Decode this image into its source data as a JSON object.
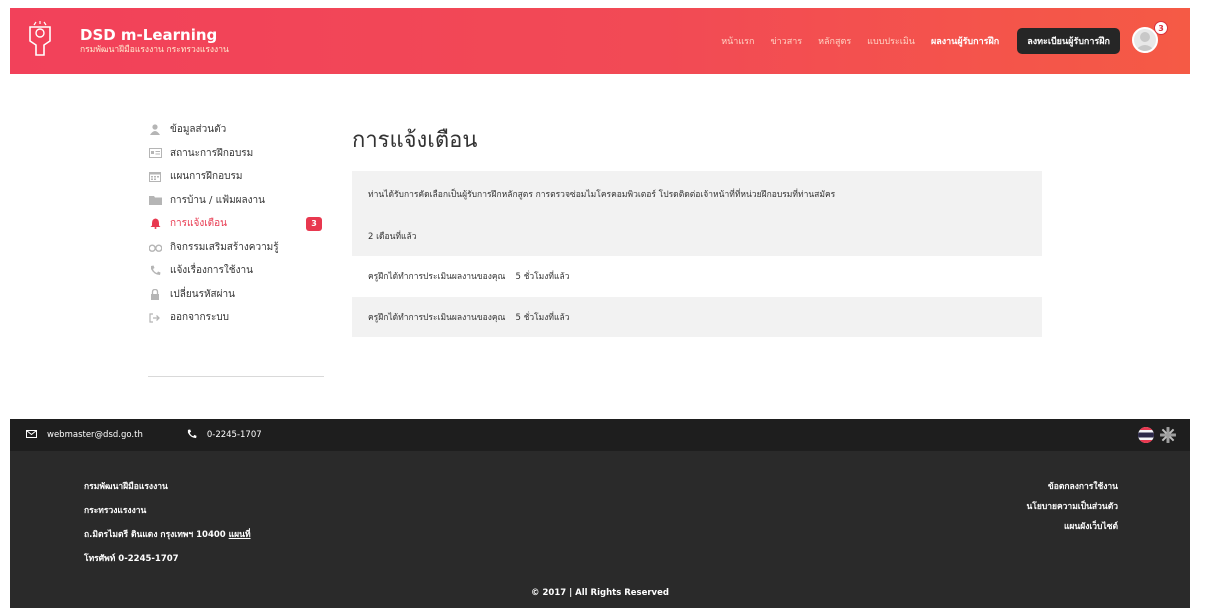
{
  "header": {
    "brand_title": "DSD m-Learning",
    "brand_subtitle": "กรมพัฒนาฝีมือแรงงาน กระทรวงแรงงาน",
    "nav": [
      "หน้าแรก",
      "ข่าวสาร",
      "หลักสูตร",
      "แบบประเมิน",
      "ผลงานผู้รับการฝึก"
    ],
    "register_button": "ลงทะเบียนผู้รับการฝึก",
    "avatar_badge": "3"
  },
  "sidebar": {
    "items": [
      {
        "label": "ข้อมูลส่วนตัว",
        "icon": "user-icon"
      },
      {
        "label": "สถานะการฝึกอบรม",
        "icon": "id-card-icon"
      },
      {
        "label": "แผนการฝึกอบรม",
        "icon": "calendar-icon"
      },
      {
        "label": "การบ้าน / แฟ้มผลงาน",
        "icon": "folder-icon"
      },
      {
        "label": "การแจ้งเตือน",
        "icon": "bell-icon",
        "badge": "3"
      },
      {
        "label": "กิจกรรมเสริมสร้างความรู้",
        "icon": "binoculars-icon"
      },
      {
        "label": "แจ้งเรื่องการใช้งาน",
        "icon": "phone-icon"
      },
      {
        "label": "เปลี่ยนรหัสผ่าน",
        "icon": "lock-icon"
      },
      {
        "label": "ออกจากระบบ",
        "icon": "sign-out-icon"
      }
    ]
  },
  "main": {
    "title": "การแจ้งเตือน",
    "notifications": [
      {
        "text": "ท่านได้รับการคัดเลือกเป็นผู้รับการฝึกหลักสูตร การตรวจซ่อมไมโครคอมพิวเตอร์ โปรดติดต่อเจ้าหน้าที่ที่หน่วยฝึกอบรมที่ท่านสมัคร",
        "time": "2 เดือนที่แล้ว"
      },
      {
        "text": "ครูฝึกได้ทำการประเมินผลงานของคุณ",
        "time": "5 ชั่วโมงที่แล้ว"
      },
      {
        "text": "ครูฝึกได้ทำการประเมินผลงานของคุณ",
        "time": "5 ชั่วโมงที่แล้ว"
      }
    ]
  },
  "footer": {
    "email": "webmaster@dsd.go.th",
    "phone": "0-2245-1707",
    "org_name": "กรมพัฒนาฝีมือแรงงาน",
    "ministry": "กระทรวงแรงงาน",
    "address": "ถ.มิตรไมตรี ดินแดง กรุงเทพฯ 10400",
    "map_link": "แผนที่",
    "tel_line": "โทรศัพท์ 0-2245-1707",
    "links": [
      "ข้อตกลงการใช้งาน",
      "นโยบายความเป็นส่วนตัว",
      "แผนผังเว็บไซต์"
    ],
    "copyright": "© 2017 | All Rights Reserved"
  },
  "colors": {
    "accent": "#e8384f",
    "header_start": "#f2415a",
    "header_end": "#f55a45",
    "footer": "#2a2a2a"
  }
}
